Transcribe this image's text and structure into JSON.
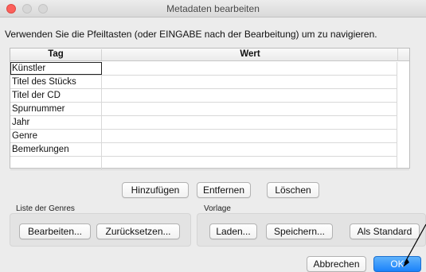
{
  "window": {
    "title": "Metadaten bearbeiten"
  },
  "instruction": "Verwenden Sie die Pfeiltasten (oder EINGABE nach der Bearbeitung) um zu navigieren.",
  "table": {
    "headers": {
      "tag": "Tag",
      "wert": "Wert"
    },
    "rows": [
      {
        "tag": "Künstler",
        "wert": ""
      },
      {
        "tag": "Titel des Stücks",
        "wert": ""
      },
      {
        "tag": "Titel der CD",
        "wert": ""
      },
      {
        "tag": "Spurnummer",
        "wert": ""
      },
      {
        "tag": "Jahr",
        "wert": ""
      },
      {
        "tag": "Genre",
        "wert": ""
      },
      {
        "tag": "Bemerkungen",
        "wert": ""
      },
      {
        "tag": "",
        "wert": ""
      }
    ]
  },
  "table_actions": {
    "add": "Hinzufügen",
    "remove": "Entfernen",
    "clear": "Löschen"
  },
  "genres_group": {
    "label": "Liste der Genres",
    "edit": "Bearbeiten...",
    "reset": "Zurücksetzen..."
  },
  "template_group": {
    "label": "Vorlage",
    "load": "Laden...",
    "save": "Speichern...",
    "default": "Als Standard"
  },
  "footer": {
    "cancel": "Abbrechen",
    "ok": "OK"
  },
  "colors": {
    "close_button": "#fc605b",
    "ok_button": "#1a82fb",
    "window_bg": "#ececec"
  }
}
